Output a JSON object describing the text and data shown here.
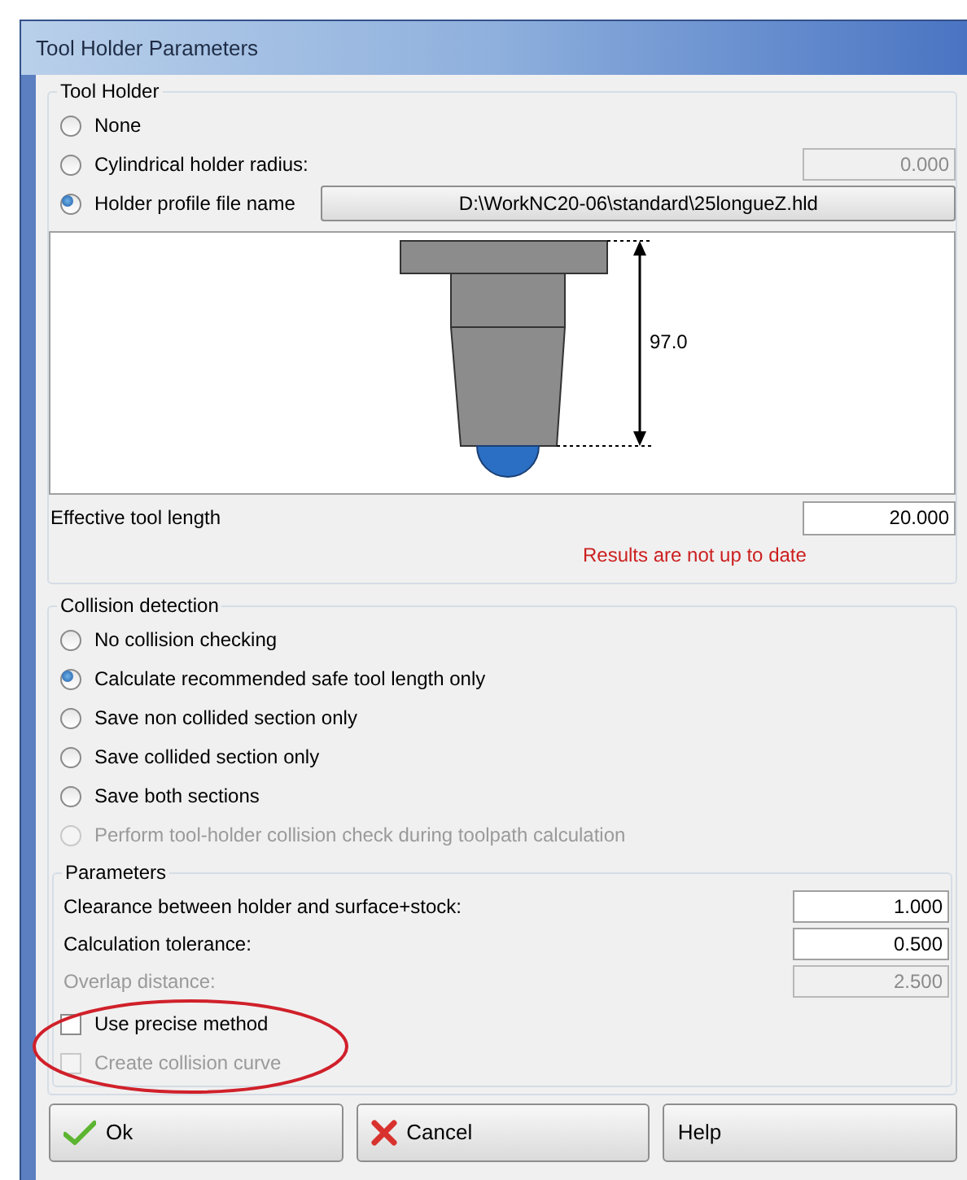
{
  "window": {
    "title": "Tool Holder Parameters"
  },
  "tool_holder": {
    "title": "Tool Holder",
    "options": [
      {
        "kind": "plain",
        "label": "None",
        "selected": false
      },
      {
        "kind": "value",
        "label": "Cylindrical holder radius:",
        "selected": false,
        "value": "0.000",
        "disabled": true
      },
      {
        "kind": "file",
        "label": "Holder profile file name",
        "selected": true,
        "file": "D:\\WorkNC20-06\\standard\\25longueZ.hld"
      }
    ],
    "preview": {
      "dimension": "97.0"
    },
    "effective_tool_length": {
      "label": "Effective tool length",
      "value": "20.000"
    },
    "warning": "Results are not up to date"
  },
  "collision_detection": {
    "title": "Collision detection",
    "options": [
      {
        "label": "No collision checking",
        "selected": false,
        "disabled": false
      },
      {
        "label": "Calculate recommended safe tool length only",
        "selected": true,
        "disabled": false
      },
      {
        "label": "Save non collided section only",
        "selected": false,
        "disabled": false
      },
      {
        "label": "Save collided section only",
        "selected": false,
        "disabled": false
      },
      {
        "label": "Save both sections",
        "selected": false,
        "disabled": false
      },
      {
        "label": "Perform tool-holder collision check during toolpath calculation",
        "selected": false,
        "disabled": true
      }
    ],
    "parameters": {
      "title": "Parameters",
      "fields": [
        {
          "label": "Clearance between holder and surface+stock:",
          "value": "1.000",
          "disabled": false
        },
        {
          "label": "Calculation tolerance:",
          "value": "0.500",
          "disabled": false
        },
        {
          "label": "Overlap distance:",
          "value": "2.500",
          "disabled": true
        }
      ],
      "checkboxes": [
        {
          "label": "Use precise method",
          "checked": false,
          "disabled": false
        },
        {
          "label": "Create collision curve",
          "checked": false,
          "disabled": true
        }
      ]
    }
  },
  "buttons": [
    {
      "kind": "ok",
      "label": "Ok"
    },
    {
      "kind": "cancel",
      "label": "Cancel"
    },
    {
      "kind": "help",
      "label": "Help"
    }
  ]
}
